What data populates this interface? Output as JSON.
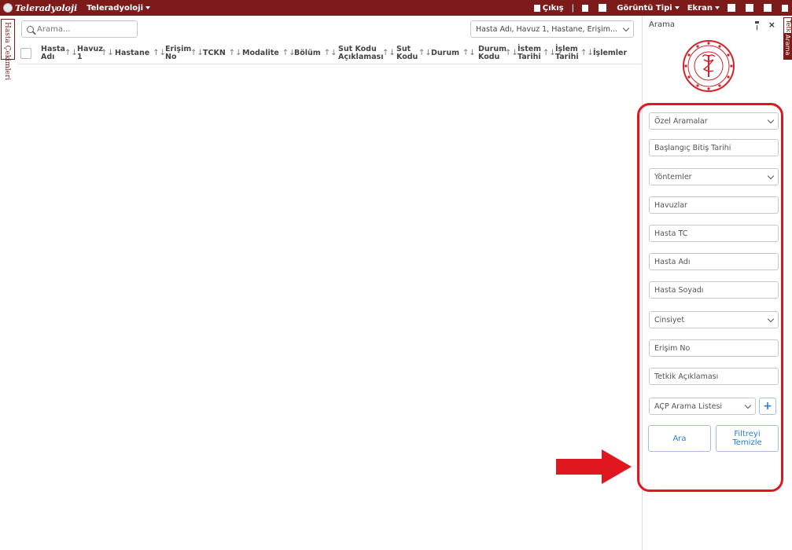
{
  "topbar": {
    "brand": "Teleradyoloji",
    "app_menu": "Teleradyoloji",
    "logout": "Çıkış",
    "separator": "|",
    "view_type": "Görüntü Tipi",
    "screen": "Ekran"
  },
  "left_tab": {
    "label": "Hasta Çekimleri"
  },
  "search": {
    "placeholder": "Arama..."
  },
  "column_selector": {
    "value": "Hasta Adı, Havuz 1, Hastane, Erişim..."
  },
  "grid": {
    "columns": [
      {
        "label": "Hasta Adı"
      },
      {
        "label": "Havuz 1"
      },
      {
        "label": "Hastane"
      },
      {
        "label": "Erişim No"
      },
      {
        "label": "TCKN"
      },
      {
        "label": "Modalite"
      },
      {
        "label": "Bölüm"
      },
      {
        "label": "Sut Kodu Açıklaması"
      },
      {
        "label": "Sut Kodu"
      },
      {
        "label": "Durum"
      },
      {
        "label": "Durum Kodu"
      },
      {
        "label": "İstem Tarihi"
      },
      {
        "label": "İşlem Tarihi"
      },
      {
        "label": "İşlemler"
      }
    ],
    "sort_glyph": "↑↓"
  },
  "right_panel": {
    "title": "Arama",
    "close": "×",
    "fields": {
      "special_searches": "Özel Aramalar",
      "date_range": "Başlangıç Bitiş Tarihi",
      "methods": "Yöntemler",
      "pools": "Havuzlar",
      "patient_tc": "Hasta TC",
      "patient_name": "Hasta Adı",
      "patient_surname": "Hasta Soyadı",
      "gender": "Cinsiyet",
      "access_no": "Erişim No",
      "exam_description": "Tetkik Açıklaması",
      "acp_list": "AÇP Arama Listesi"
    },
    "plus": "+",
    "search_button": "Ara",
    "clear_button": "Filtreyi Temizle"
  },
  "right_tabs": {
    "tab1": "Tetkik",
    "tab2": "Arama"
  },
  "colors": {
    "brand": "#7d1a1a",
    "highlight": "#e0171f",
    "accent": "#2b7bd3"
  }
}
